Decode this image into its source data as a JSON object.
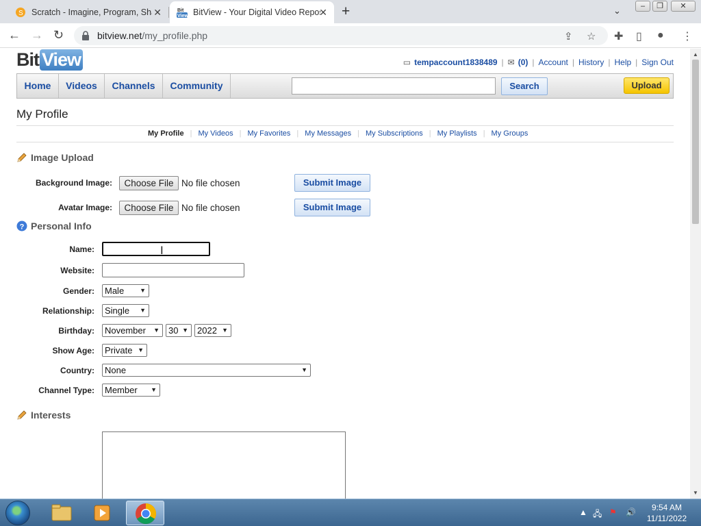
{
  "browser": {
    "tabs": [
      {
        "title": "Scratch - Imagine, Program, Share",
        "active": false,
        "favicon": "scratch-icon"
      },
      {
        "title": "BitView - Your Digital Video Repository",
        "active": true,
        "favicon": "bitview-icon"
      }
    ],
    "url_domain": "bitview.net",
    "url_path": "/my_profile.php"
  },
  "site": {
    "logo_bit": "Bit",
    "logo_view": "View",
    "user": {
      "username": "tempaccount1838489",
      "message_count": "(0)",
      "links": [
        "Account",
        "History",
        "Help",
        "Sign Out"
      ]
    },
    "nav": [
      "Home",
      "Videos",
      "Channels",
      "Community"
    ],
    "search_button": "Search",
    "upload_button": "Upload"
  },
  "page": {
    "title": "My Profile",
    "subnav": [
      "My Profile",
      "My Videos",
      "My Favorites",
      "My Messages",
      "My Subscriptions",
      "My Playlists",
      "My Groups"
    ]
  },
  "image_upload": {
    "heading": "Image Upload",
    "rows": [
      {
        "label": "Background Image:",
        "choose": "Choose File",
        "status": "No file chosen",
        "submit": "Submit Image"
      },
      {
        "label": "Avatar Image:",
        "choose": "Choose File",
        "status": "No file chosen",
        "submit": "Submit Image"
      }
    ]
  },
  "personal_info": {
    "heading": "Personal Info",
    "name_label": "Name:",
    "name_value": "",
    "website_label": "Website:",
    "website_value": "",
    "gender_label": "Gender:",
    "gender_value": "Male",
    "relationship_label": "Relationship:",
    "relationship_value": "Single",
    "birthday_label": "Birthday:",
    "birthday_month": "November",
    "birthday_day": "30",
    "birthday_year": "2022",
    "show_age_label": "Show Age:",
    "show_age_value": "Private",
    "country_label": "Country:",
    "country_value": "None",
    "channel_type_label": "Channel Type:",
    "channel_type_value": "Member"
  },
  "interests": {
    "heading": "Interests",
    "value": ""
  },
  "taskbar": {
    "time": "9:54 AM",
    "date": "11/11/2022"
  },
  "colors": {
    "link_blue": "#1a4da2",
    "upload_yellow": "#f5c400",
    "taskbar_blue": "#3c6690"
  }
}
